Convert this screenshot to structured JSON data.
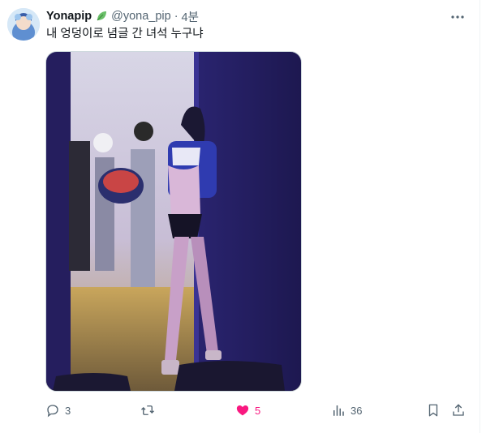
{
  "tweet": {
    "display_name": "Yonapip",
    "handle": "@yona_pip",
    "separator": "·",
    "time": "4분",
    "text": "내 엉덩이로 념글 간 녀석 누구냐",
    "badge_icon": "leaf-icon",
    "badge_color": "#6abf69"
  },
  "actions": {
    "replies": "3",
    "retweets": "",
    "likes": "5",
    "views": "36",
    "like_color": "#f91880",
    "muted_color": "#536471"
  },
  "media": {
    "alt_icon": "photo-icon"
  }
}
